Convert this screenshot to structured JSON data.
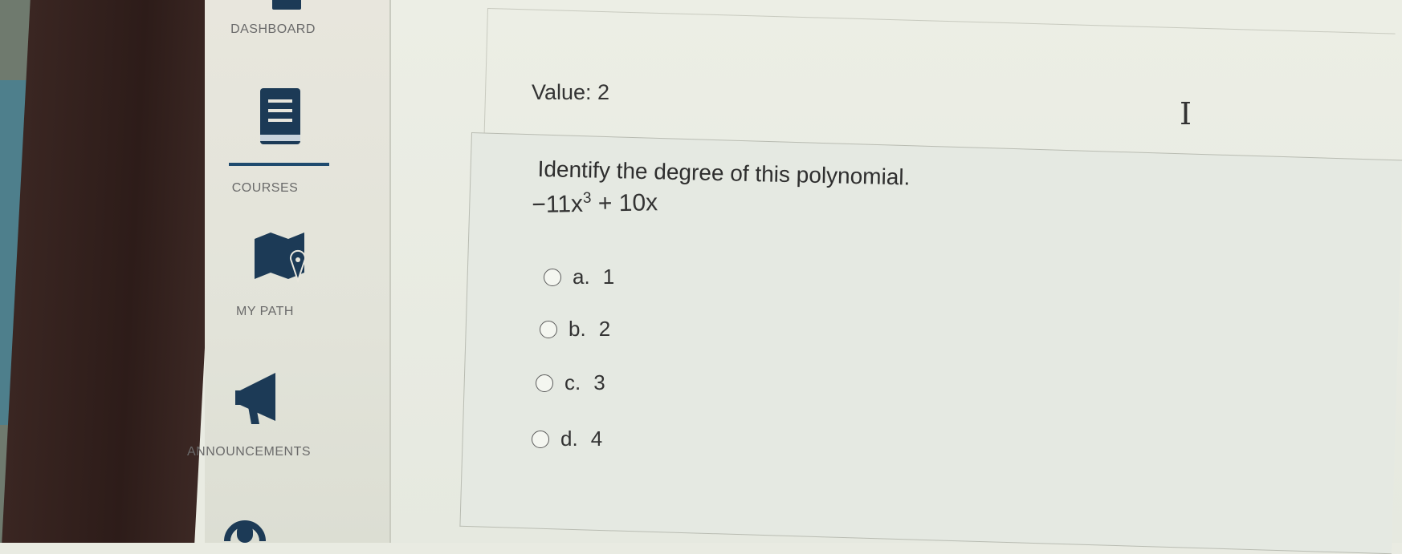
{
  "sidebar": {
    "items": [
      {
        "label": "DASHBOARD",
        "icon": "dashboard-icon"
      },
      {
        "label": "COURSES",
        "icon": "book-icon"
      },
      {
        "label": "MY PATH",
        "icon": "map-icon"
      },
      {
        "label": "ANNOUNCEMENTS",
        "icon": "megaphone-icon"
      },
      {
        "label": "",
        "icon": "headset-icon"
      }
    ]
  },
  "question": {
    "value_label": "Value: 2",
    "prompt": "Identify the degree of this polynomial.",
    "expression": {
      "part1": "−11x",
      "exponent": "3",
      "part2": " + 10x"
    },
    "options": [
      {
        "letter": "a.",
        "value": "1"
      },
      {
        "letter": "b.",
        "value": "2"
      },
      {
        "letter": "c.",
        "value": "3"
      },
      {
        "letter": "d.",
        "value": "4"
      }
    ]
  },
  "colors": {
    "sidebar_icon": "#1c3a56",
    "accent": "#1f4a6e"
  }
}
